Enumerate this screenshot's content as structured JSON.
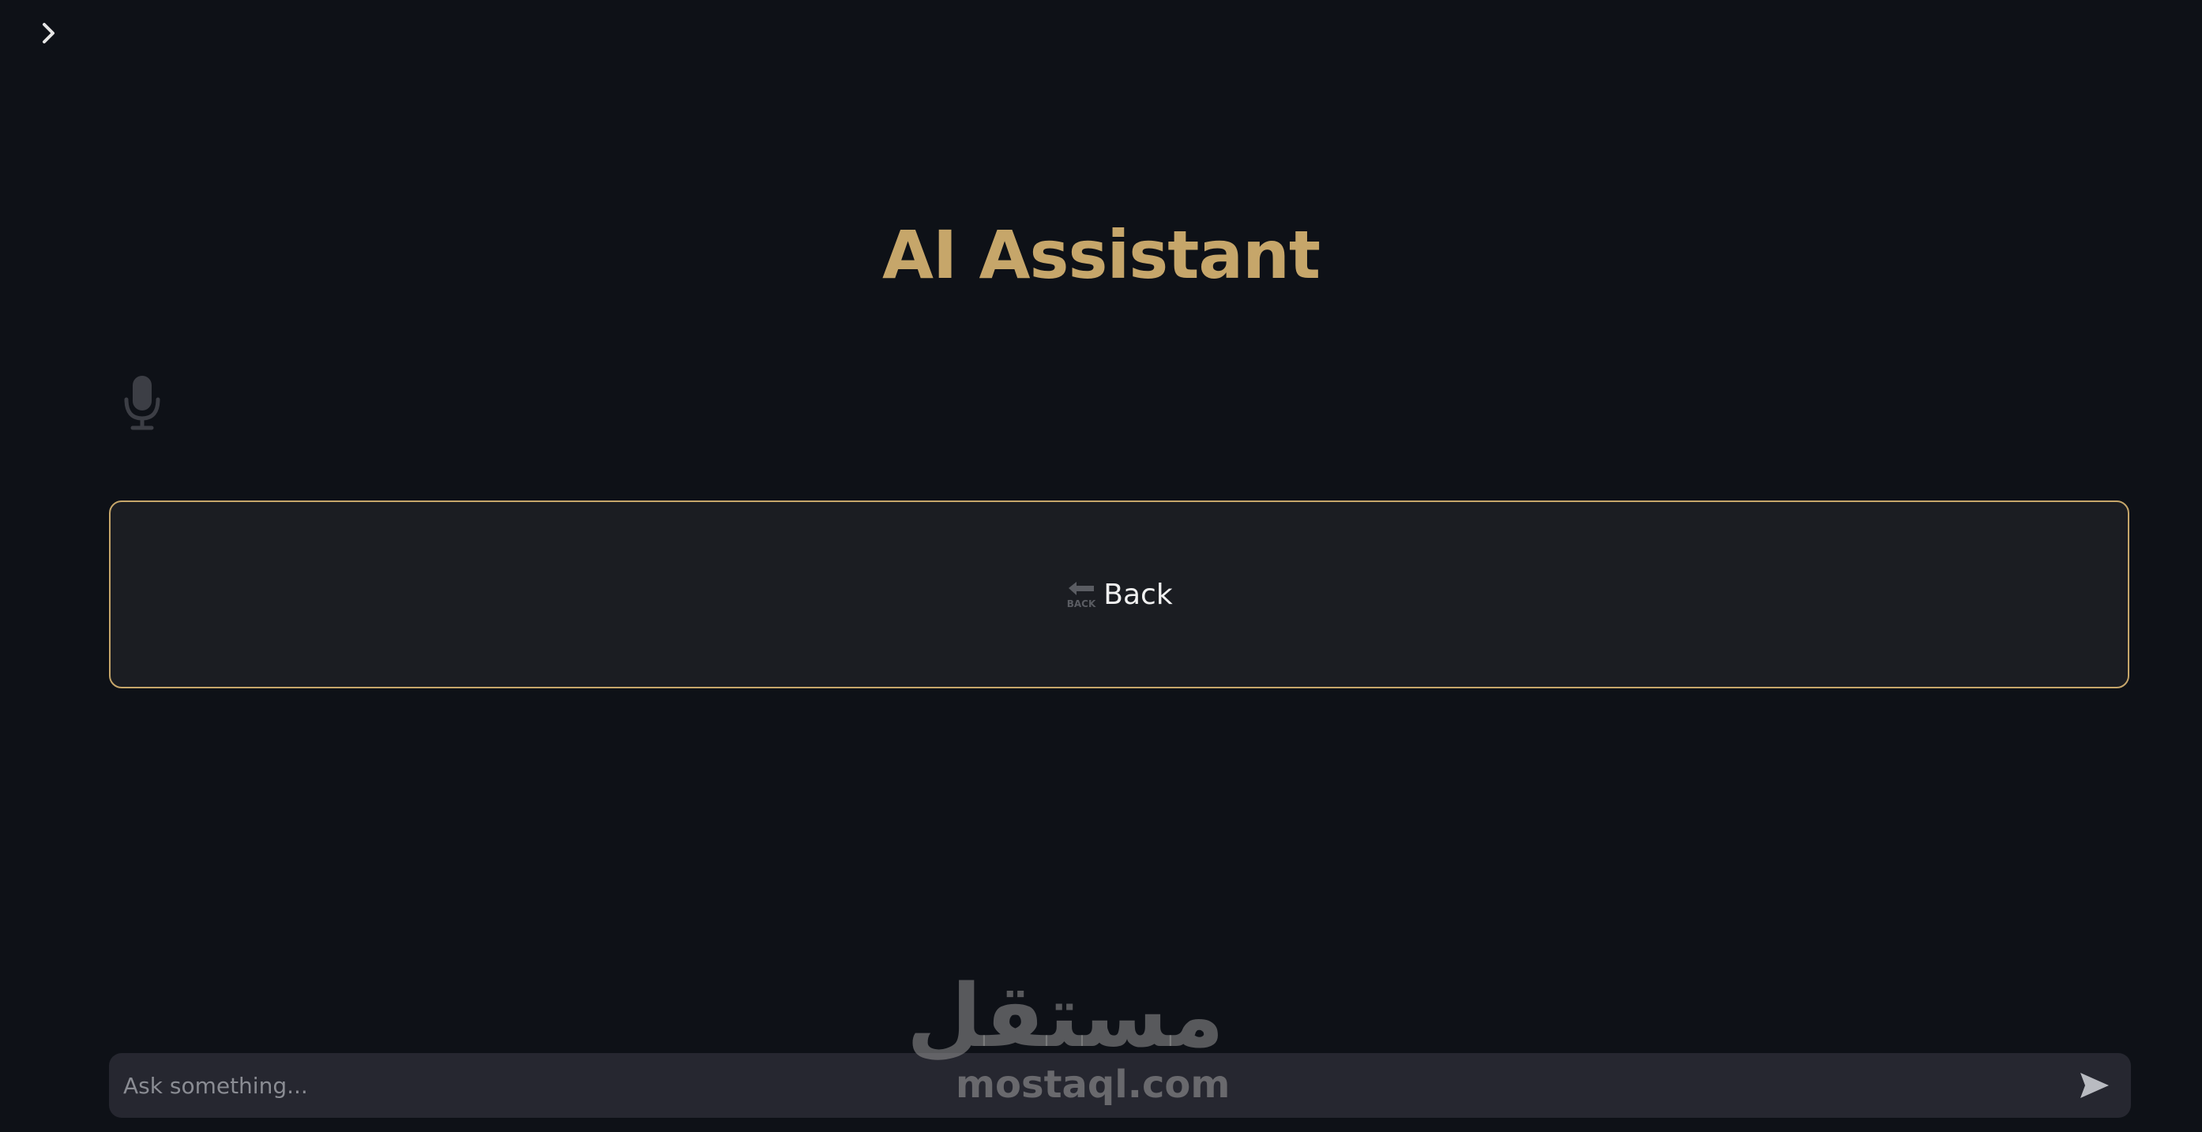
{
  "app": {
    "title": "AI Assistant"
  },
  "sidebar_toggle": {
    "icon": "chevron-right-icon"
  },
  "mic": {
    "icon": "microphone-icon"
  },
  "back_card": {
    "icon": "back-arrow-icon",
    "icon_text": "BACK",
    "label": "Back"
  },
  "chat": {
    "placeholder": "Ask something...",
    "send_icon": "send-icon"
  },
  "watermark": {
    "arabic": "مستقل",
    "english": "mostaql.com"
  },
  "colors": {
    "background": "#0e1117",
    "accent_gold": "#c6a66a",
    "card_background": "#1b1d22",
    "input_background": "#262730"
  }
}
